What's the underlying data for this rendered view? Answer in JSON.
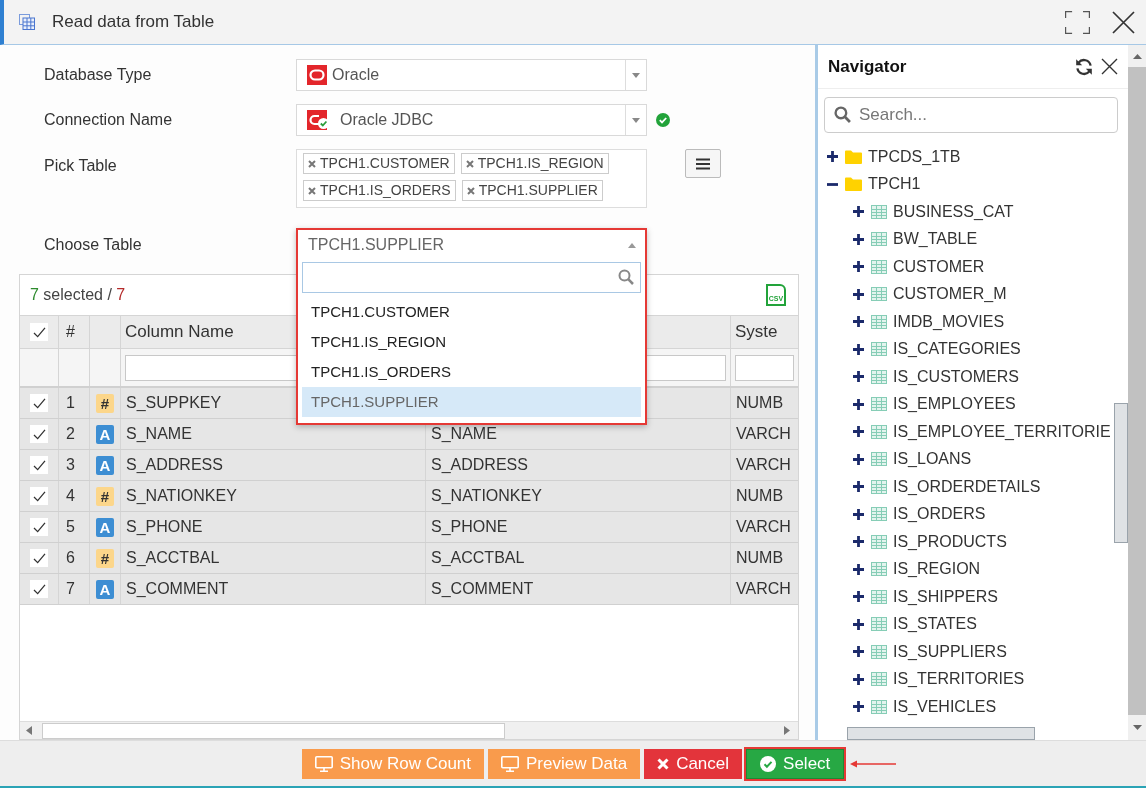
{
  "window": {
    "title": "Read data from Table"
  },
  "form": {
    "database_type": {
      "label": "Database Type",
      "value": "Oracle"
    },
    "connection": {
      "label": "Connection Name",
      "value": "Oracle JDBC",
      "connected": true
    },
    "pick_table": {
      "label": "Pick Table",
      "chips": [
        "TPCH1.CUSTOMER",
        "TPCH1.IS_REGION",
        "TPCH1.IS_ORDERS",
        "TPCH1.SUPPLIER"
      ]
    },
    "choose_table": {
      "label": "Choose Table",
      "value": "TPCH1.SUPPLIER",
      "expanded": true,
      "highlighted": true,
      "options": [
        {
          "label": "TPCH1.CUSTOMER",
          "selected": false
        },
        {
          "label": "TPCH1.IS_REGION",
          "selected": false
        },
        {
          "label": "TPCH1.IS_ORDERS",
          "selected": false
        },
        {
          "label": "TPCH1.SUPPLIER",
          "selected": true
        }
      ]
    }
  },
  "table": {
    "selected_count": "7",
    "selected_text": "selected /",
    "total": "7",
    "export_label": "CSV",
    "all_checked": true,
    "index_header": "#",
    "columns": [
      {
        "label": "Column Name",
        "filter_field": true
      },
      {
        "filter_field": true
      },
      {
        "label": "Syste",
        "filter_field": true
      }
    ],
    "rows": [
      {
        "checked": true,
        "number": "1",
        "kind": "numeric",
        "badge": "#",
        "column_1": "S_SUPPKEY",
        "column_3": "NUMB"
      },
      {
        "checked": true,
        "number": "2",
        "kind": "text",
        "badge": "A",
        "column_1": "S_NAME",
        "column_2": "S_NAME",
        "column_3": "VARCH"
      },
      {
        "checked": true,
        "number": "3",
        "kind": "text",
        "badge": "A",
        "column_1": "S_ADDRESS",
        "column_2": "S_ADDRESS",
        "column_3": "VARCH"
      },
      {
        "checked": true,
        "number": "4",
        "kind": "numeric",
        "badge": "#",
        "column_1": "S_NATIONKEY",
        "column_2": "S_NATIONKEY",
        "column_3": "NUMB"
      },
      {
        "checked": true,
        "number": "5",
        "kind": "text",
        "badge": "A",
        "column_1": "S_PHONE",
        "column_2": "S_PHONE",
        "column_3": "VARCH"
      },
      {
        "checked": true,
        "number": "6",
        "kind": "numeric",
        "badge": "#",
        "column_1": "S_ACCTBAL",
        "column_2": "S_ACCTBAL",
        "column_3": "NUMB"
      },
      {
        "checked": true,
        "number": "7",
        "kind": "text",
        "badge": "A",
        "column_1": "S_COMMENT",
        "column_2": "S_COMMENT",
        "column_3": "VARCH"
      }
    ]
  },
  "navigator": {
    "title": "Navigator",
    "search": {
      "placeholder": "Search..."
    },
    "tree": [
      {
        "label": "TPCDS_1TB",
        "kind": "schema",
        "expanded": false
      },
      {
        "label": "TPCH1",
        "kind": "schema",
        "expanded": true,
        "children": [
          {
            "label": "BUSINESS_CAT",
            "kind": "table",
            "expanded": false
          },
          {
            "label": "BW_TABLE",
            "kind": "table",
            "expanded": false
          },
          {
            "label": "CUSTOMER",
            "kind": "table",
            "expanded": false
          },
          {
            "label": "CUSTOMER_M",
            "kind": "table",
            "expanded": false
          },
          {
            "label": "IMDB_MOVIES",
            "kind": "table",
            "expanded": false
          },
          {
            "label": "IS_CATEGORIES",
            "kind": "table",
            "expanded": false
          },
          {
            "label": "IS_CUSTOMERS",
            "kind": "table",
            "expanded": false
          },
          {
            "label": "IS_EMPLOYEES",
            "kind": "table",
            "expanded": false
          },
          {
            "label": "IS_EMPLOYEE_TERRITORIE",
            "kind": "table",
            "expanded": false
          },
          {
            "label": "IS_LOANS",
            "kind": "table",
            "expanded": false
          },
          {
            "label": "IS_ORDERDETAILS",
            "kind": "table",
            "expanded": false
          },
          {
            "label": "IS_ORDERS",
            "kind": "table",
            "expanded": false
          },
          {
            "label": "IS_PRODUCTS",
            "kind": "table",
            "expanded": false
          },
          {
            "label": "IS_REGION",
            "kind": "table",
            "expanded": false
          },
          {
            "label": "IS_SHIPPERS",
            "kind": "table",
            "expanded": false
          },
          {
            "label": "IS_STATES",
            "kind": "table",
            "expanded": false
          },
          {
            "label": "IS_SUPPLIERS",
            "kind": "table",
            "expanded": false
          },
          {
            "label": "IS_TERRITORIES",
            "kind": "table",
            "expanded": false
          },
          {
            "label": "IS_VEHICLES",
            "kind": "table",
            "expanded": false
          }
        ]
      }
    ]
  },
  "buttons": [
    {
      "label": "Show Row Count",
      "kind": "secondary",
      "highlighted": false
    },
    {
      "label": "Preview Data",
      "kind": "secondary",
      "highlighted": false
    },
    {
      "label": "Cancel",
      "kind": "danger",
      "highlighted": false
    },
    {
      "label": "Select",
      "kind": "primary",
      "highlighted": true
    }
  ]
}
